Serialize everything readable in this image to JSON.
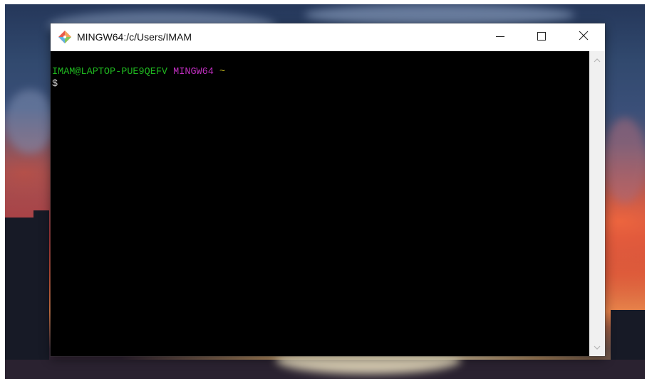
{
  "window": {
    "title": "MINGW64:/c/Users/IMAM",
    "buttons": {
      "minimize_icon": "minimize-icon",
      "maximize_icon": "maximize-icon",
      "close_icon": "close-icon"
    }
  },
  "terminal": {
    "prompt_user_host": "IMAM@LAPTOP-PUE9QEFV",
    "prompt_env": "MINGW64",
    "prompt_path": "~",
    "prompt_symbol": "$",
    "colors": {
      "user_host": "#1fb61f",
      "env": "#c22fc2",
      "path": "#c4b81e",
      "background": "#000000"
    }
  },
  "scrollbar": {
    "up_icon": "chevron-up-icon",
    "down_icon": "chevron-down-icon"
  }
}
